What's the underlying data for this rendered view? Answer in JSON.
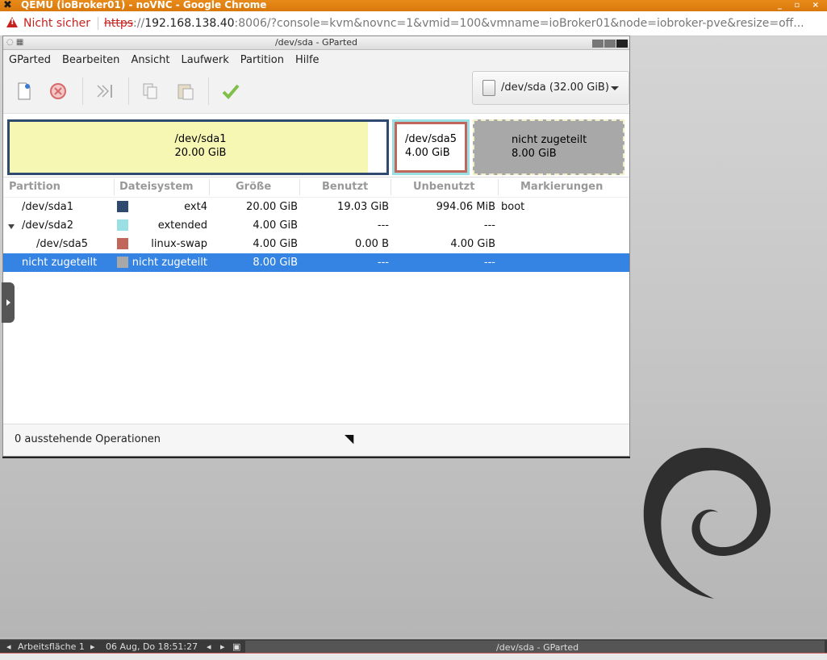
{
  "browser": {
    "title": "QEMU (ioBroker01) - noVNC - Google Chrome",
    "security_label": "Nicht sicher",
    "url_protocol": "https",
    "url_separator": "://",
    "url_host": "192.168.138.40",
    "url_rest": ":8006/?console=kvm&novnc=1&vmid=100&vmname=ioBroker01&node=iobroker-pve&resize=off..."
  },
  "window": {
    "title": "/dev/sda - GParted"
  },
  "menu": [
    "GParted",
    "Bearbeiten",
    "Ansicht",
    "Laufwerk",
    "Partition",
    "Hilfe"
  ],
  "toolbar": {
    "icons": [
      "new-icon",
      "delete-icon",
      "resize-move-icon",
      "copy-icon",
      "paste-icon",
      "apply-icon"
    ]
  },
  "device_selector": {
    "label": "/dev/sda (32.00 GiB)"
  },
  "diskmap": [
    {
      "name": "/dev/sda1",
      "size": "20.00 GiB",
      "color": "#2e4a6e",
      "fill": "#f7f7b4",
      "used_fraction": 0.95
    },
    {
      "name": "/dev/sda5",
      "size": "4.00 GiB",
      "color": "#c1665a",
      "outer": "#99dfe3"
    },
    {
      "name": "nicht zugeteilt",
      "size": "8.00 GiB",
      "color": "#a8a8a8"
    }
  ],
  "table": {
    "headers": [
      "Partition",
      "Dateisystem",
      "Größe",
      "Benutzt",
      "Unbenutzt",
      "Markierungen"
    ],
    "rows": [
      {
        "partition": "/dev/sda1",
        "filesystem": "ext4",
        "color": "#2e4a6e",
        "size": "20.00 GiB",
        "used": "19.03 GiB",
        "unused": "994.06 MiB",
        "flags": "boot"
      },
      {
        "partition": "/dev/sda2",
        "filesystem": "extended",
        "color": "#99dfe3",
        "size": "4.00 GiB",
        "used": "---",
        "unused": "---",
        "flags": ""
      },
      {
        "partition": "/dev/sda5",
        "filesystem": "linux-swap",
        "color": "#c1665a",
        "size": "4.00 GiB",
        "used": "0.00 B",
        "unused": "4.00 GiB",
        "flags": ""
      },
      {
        "partition": "nicht zugeteilt",
        "filesystem": "nicht zugeteilt",
        "color": "#a8a8a8",
        "size": "8.00 GiB",
        "used": "---",
        "unused": "---",
        "flags": ""
      }
    ]
  },
  "status": {
    "pending": "0 ausstehende Operationen"
  },
  "taskbar": {
    "workspace": "Arbeitsfläche 1",
    "datetime": "06 Aug, Do 18:51:27",
    "task": "/dev/sda - GParted"
  }
}
